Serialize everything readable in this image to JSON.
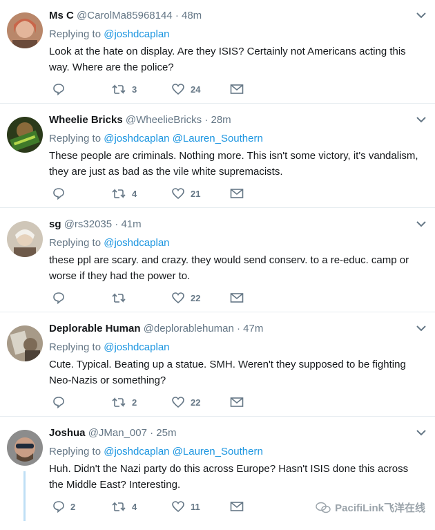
{
  "tweets": [
    {
      "name": "Ms C",
      "meta": "@CarolMa85968144 · 48m",
      "replying_prefix": "Replying to",
      "mentions": "@joshdcaplan",
      "text": "Look at the hate on display. Are they ISIS? Certainly not Americans acting this way. Where are the police?",
      "reply_count": "",
      "retweet_count": "3",
      "like_count": "24"
    },
    {
      "name": "Wheelie Bricks",
      "meta": "@WheelieBricks · 28m",
      "replying_prefix": "Replying to",
      "mentions": "@joshdcaplan @Lauren_Southern",
      "text": "These people are criminals. Nothing more. This isn't some victory, it's vandalism, they are just as bad as the vile white supremacists.",
      "reply_count": "",
      "retweet_count": "4",
      "like_count": "21"
    },
    {
      "name": "sg",
      "meta": "@rs32035 · 41m",
      "replying_prefix": "Replying to",
      "mentions": "@joshdcaplan",
      "text": "these ppl are scary. and crazy. they would send conserv. to a re-educ. camp or worse if they had the power to.",
      "reply_count": "",
      "retweet_count": "",
      "like_count": "22"
    },
    {
      "name": "Deplorable Human",
      "meta": "@deplorablehuman · 47m",
      "replying_prefix": "Replying to",
      "mentions": "@joshdcaplan",
      "text": "Cute. Typical. Beating up a statue. SMH. Weren't they supposed to be fighting Neo-Nazis or something?",
      "reply_count": "",
      "retweet_count": "2",
      "like_count": "22"
    },
    {
      "name": "Joshua",
      "meta": "@JMan_007 · 25m",
      "replying_prefix": "Replying to",
      "mentions": "@joshdcaplan @Lauren_Southern",
      "text": "Huh. Didn't the Nazi party do this across Europe? Hasn't ISIS done this across the Middle East? Interesting.",
      "reply_count": "2",
      "retweet_count": "4",
      "like_count": "11"
    }
  ],
  "watermark": "PacifiLink飞洋在线",
  "colors": {
    "link": "#1b95e0",
    "meta": "#657786",
    "text": "#14171a",
    "divider": "#e6ecf0"
  }
}
